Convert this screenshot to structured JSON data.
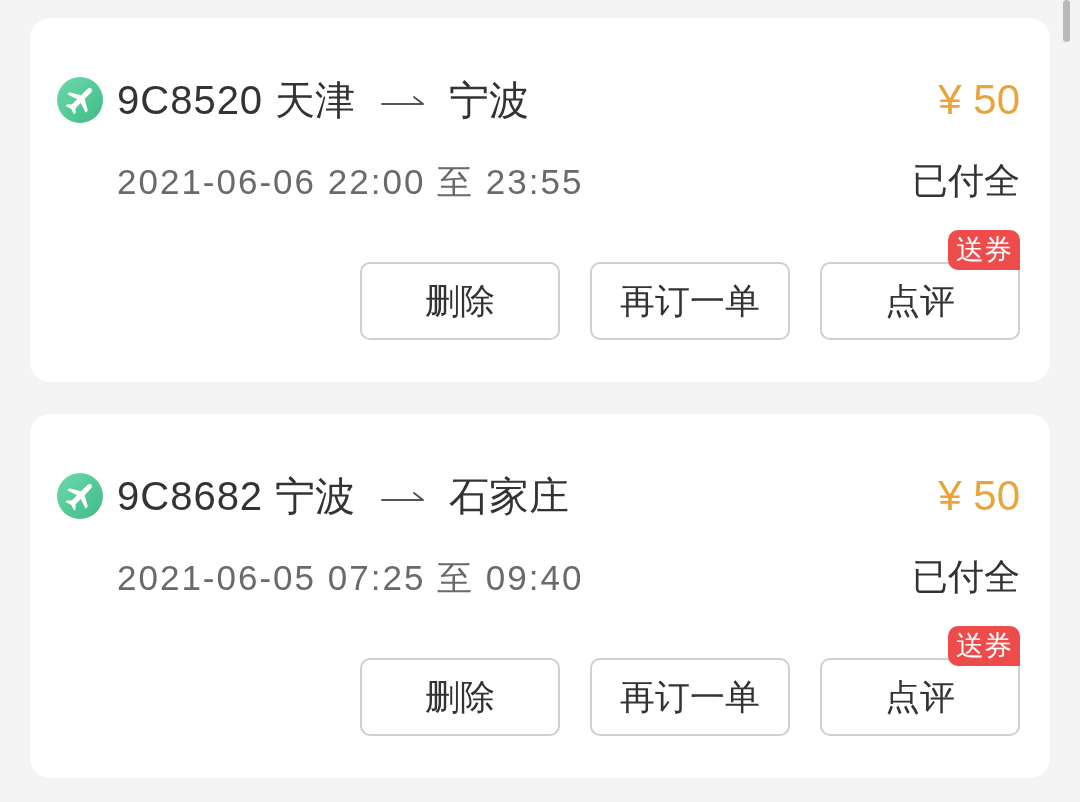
{
  "orders": [
    {
      "flight_no": "9C8520",
      "origin": "天津",
      "destination": "宁波",
      "price": "¥ 50",
      "time": "2021-06-06 22:00 至 23:55",
      "payment_status": "已付全",
      "buttons": [
        {
          "label": "删除"
        },
        {
          "label": "再订一单"
        },
        {
          "label": "点评",
          "badge": "送券"
        }
      ]
    },
    {
      "flight_no": "9C8682",
      "origin": "宁波",
      "destination": "石家庄",
      "price": "¥ 50",
      "time": "2021-06-05 07:25 至 09:40",
      "payment_status": "已付全",
      "buttons": [
        {
          "label": "删除"
        },
        {
          "label": "再订一单"
        },
        {
          "label": "点评",
          "badge": "送券"
        }
      ]
    }
  ]
}
